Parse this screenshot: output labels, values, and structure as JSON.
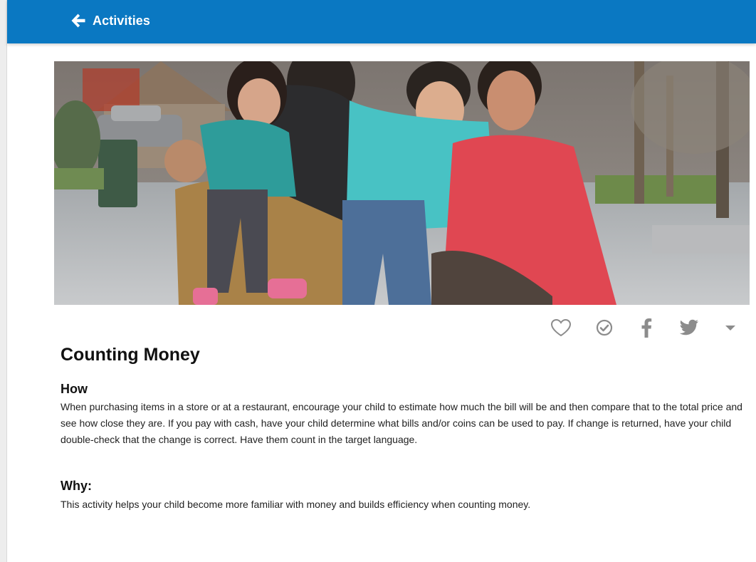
{
  "header": {
    "back_label": "Activities",
    "color": "#0a78c2"
  },
  "hero": {
    "image": "family-photo"
  },
  "actions": {
    "icons": [
      "heart-icon",
      "check-circle-icon",
      "facebook-icon",
      "twitter-icon",
      "caret-down-icon"
    ],
    "color": "#8c8c8c"
  },
  "activity": {
    "title": "Counting Money",
    "how_heading": "How",
    "how_text": "When purchasing items in a store or at a restaurant, encourage your child to estimate how much the bill will be and then compare that to the total price and see how close they are. If you pay with cash, have your child determine what bills and/or coins can be used to pay. If change is returned, have your child double-check that the change is correct. Have them count in the target language.",
    "why_heading": "Why:",
    "why_text": "This activity helps your child become more familiar with money and builds efficiency when counting money."
  }
}
